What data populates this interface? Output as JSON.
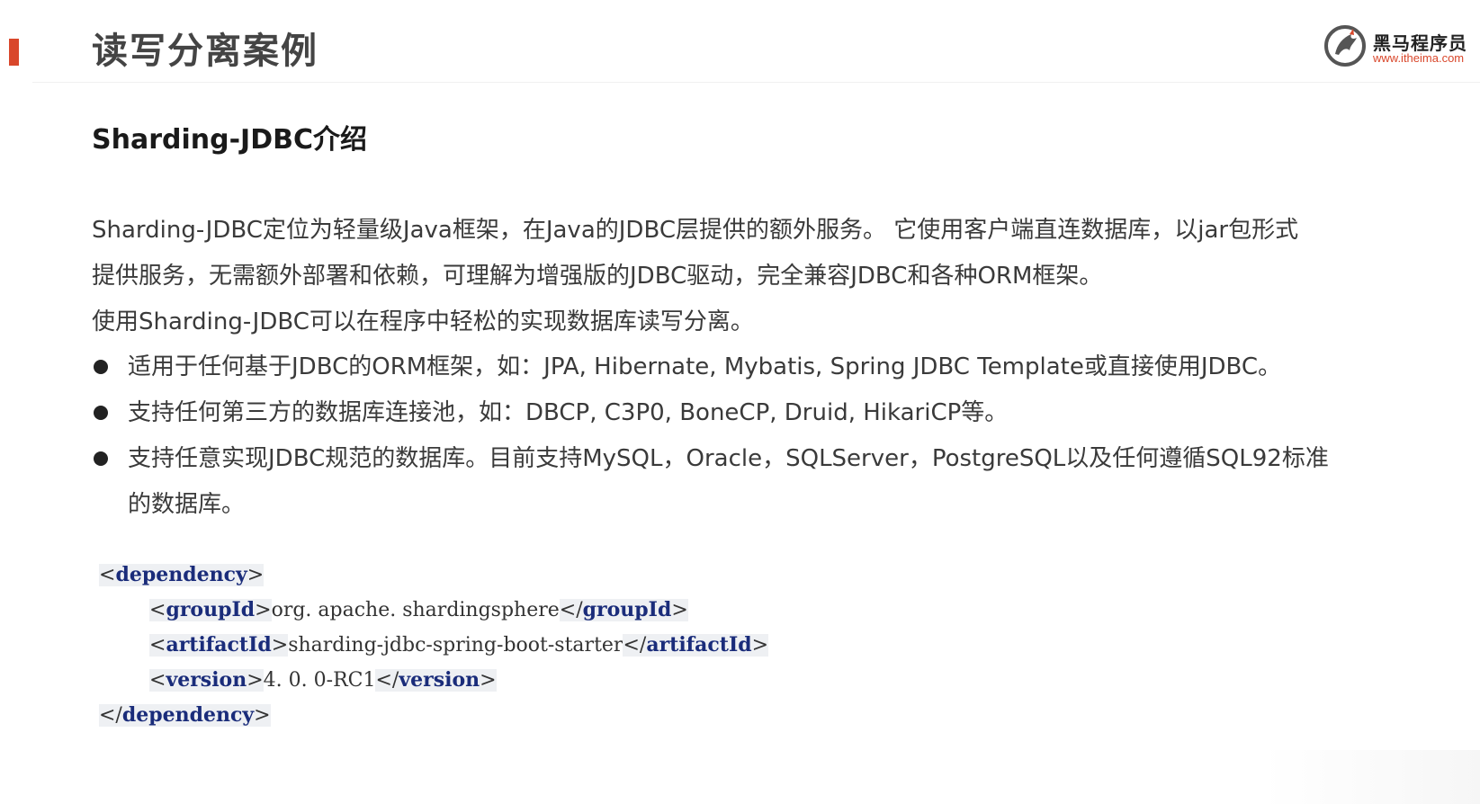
{
  "header": {
    "title": "读写分离案例",
    "accent_color": "#d9472b",
    "logo": {
      "brand": "黑马程序员",
      "url": "www.itheima.com",
      "icon": "horse-logo-icon"
    }
  },
  "section": {
    "title": "Sharding-JDBC介绍"
  },
  "paragraphs": [
    "Sharding-JDBC定位为轻量级Java框架，在Java的JDBC层提供的额外服务。 它使用客户端直连数据库，以jar包形式提供服务，无需额外部署和依赖，可理解为增强版的JDBC驱动，完全兼容JDBC和各种ORM框架。",
    "使用Sharding-JDBC可以在程序中轻松的实现数据库读写分离。"
  ],
  "paragraph_lines": [
    "Sharding-JDBC定位为轻量级Java框架，在Java的JDBC层提供的额外服务。 它使用客户端直连数据库，以jar包形式",
    "提供服务，无需额外部署和依赖，可理解为增强版的JDBC驱动，完全兼容JDBC和各种ORM框架。"
  ],
  "bullets": [
    "适用于任何基于JDBC的ORM框架，如：JPA, Hibernate, Mybatis, Spring JDBC Template或直接使用JDBC。",
    "支持任何第三方的数据库连接池，如：DBCP, C3P0, BoneCP, Druid, HikariCP等。",
    "支持任意实现JDBC规范的数据库。目前支持MySQL，Oracle，SQLServer，PostgreSQL以及任何遵循SQL92标准的数据库。"
  ],
  "bullet_3_lines": [
    "支持任意实现JDBC规范的数据库。目前支持MySQL，Oracle，SQLServer，PostgreSQL以及任何遵循SQL92标准",
    "的数据库。"
  ],
  "code": {
    "dependency_tag": "dependency",
    "groupId_tag": "groupId",
    "groupId_value": "org. apache. shardingsphere",
    "artifactId_tag": "artifactId",
    "artifactId_value": "sharding-jdbc-spring-boot-starter",
    "version_tag": "version",
    "version_value": "4. 0. 0-RC1"
  }
}
